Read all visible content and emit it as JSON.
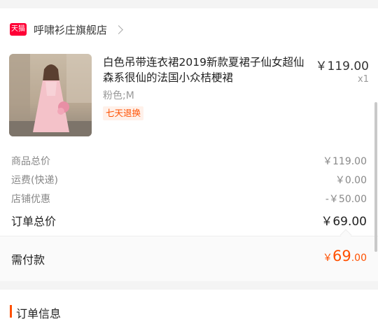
{
  "shop": {
    "badge": "天猫",
    "name": "呼啸衫庄旗舰店",
    "icon": "chevron-right-icon"
  },
  "product": {
    "title": "白色吊带连衣裙2019新款夏裙子仙女超仙森系很仙的法国小众桔梗裙",
    "price": "￥119.00",
    "quantity": "x1",
    "sku": "粉色;M",
    "service_tag": "七天退换"
  },
  "summary": {
    "items_total_label": "商品总价",
    "items_total_value": "￥119.00",
    "shipping_label": "运费(快递)",
    "shipping_value": "￥0.00",
    "discount_label": "店铺优惠",
    "discount_value": "-￥50.00",
    "order_total_label": "订单总价",
    "order_total_value": "￥69.00"
  },
  "payment": {
    "label": "需付款",
    "currency": "￥",
    "amount_int": "69",
    "amount_dec": ".00"
  },
  "order_info": {
    "heading": "订单信息"
  },
  "colors": {
    "accent": "#ff5000",
    "tmall_red": "#ff0036",
    "background": "#f4f4f4"
  }
}
